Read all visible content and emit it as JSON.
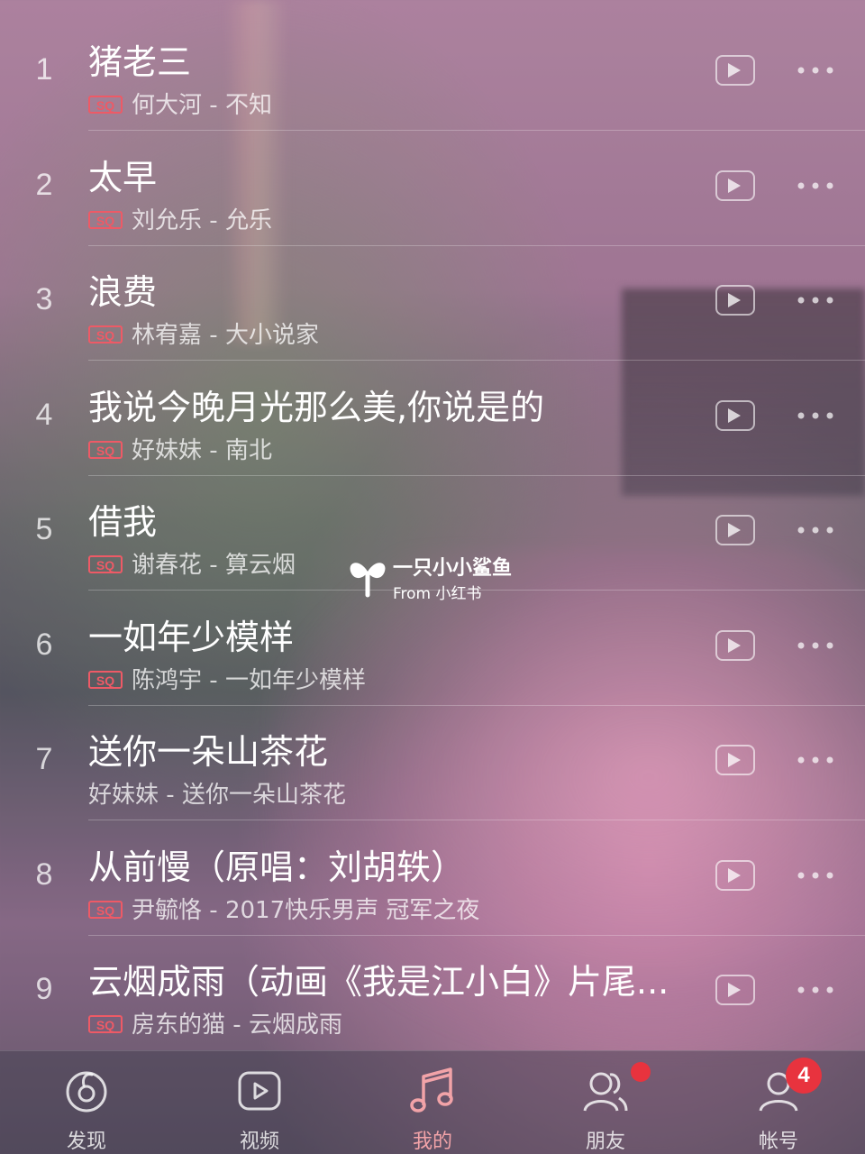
{
  "songs": [
    {
      "index": "1",
      "title": "猪老三",
      "sq": true,
      "sq_label": "SQ",
      "artist": "何大河",
      "album": "不知"
    },
    {
      "index": "2",
      "title": "太早",
      "sq": true,
      "sq_label": "SQ",
      "artist": "刘允乐",
      "album": "允乐"
    },
    {
      "index": "3",
      "title": "浪费",
      "sq": true,
      "sq_label": "SQ",
      "artist": "林宥嘉",
      "album": "大小说家"
    },
    {
      "index": "4",
      "title": "我说今晚月光那么美,你说是的",
      "sq": true,
      "sq_label": "SQ",
      "artist": "好妹妹",
      "album": "南北"
    },
    {
      "index": "5",
      "title": "借我",
      "sq": true,
      "sq_label": "SQ",
      "artist": "谢春花",
      "album": "算云烟"
    },
    {
      "index": "6",
      "title": "一如年少模样",
      "sq": true,
      "sq_label": "SQ",
      "artist": "陈鸿宇",
      "album": "一如年少模样"
    },
    {
      "index": "7",
      "title": "送你一朵山茶花",
      "sq": false,
      "sq_label": "",
      "artist": "好妹妹",
      "album": "送你一朵山茶花"
    },
    {
      "index": "8",
      "title": "从前慢（原唱：刘胡轶）",
      "sq": true,
      "sq_label": "SQ",
      "artist": "尹毓恪",
      "album": "2017快乐男声 冠军之夜"
    },
    {
      "index": "9",
      "title": "云烟成雨（动画《我是江小白》片尾...",
      "sq": true,
      "sq_label": "SQ",
      "artist": "房东的猫",
      "album": "云烟成雨"
    }
  ],
  "separator": " - ",
  "watermark": {
    "name": "一只小小鲨鱼",
    "from": "From 小红书"
  },
  "tabs": [
    {
      "label": "发现",
      "icon": "discover-icon"
    },
    {
      "label": "视频",
      "icon": "video-icon"
    },
    {
      "label": "我的",
      "icon": "music-note-icon",
      "active": true
    },
    {
      "label": "朋友",
      "icon": "friends-icon"
    },
    {
      "label": "帐号",
      "icon": "account-icon"
    }
  ],
  "account_badge": "4",
  "colors": {
    "accent": "#f2a3a8",
    "badge": "#e8333e",
    "sq": "#ee5a66"
  }
}
